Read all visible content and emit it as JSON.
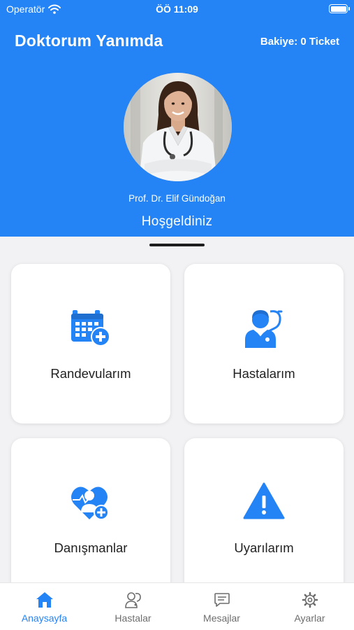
{
  "status_bar": {
    "carrier": "Operatör",
    "time": "ÖÖ 11:09"
  },
  "header": {
    "app_title": "Doktorum Yanımda",
    "balance": "Bakiye: 0 Ticket",
    "doctor_name": "Prof. Dr. Elif Gündoğan",
    "welcome": "Hoşgeldiniz"
  },
  "cards": [
    {
      "label": "Randevularım",
      "icon": "calendar-plus-icon"
    },
    {
      "label": "Hastalarım",
      "icon": "doctor-stethoscope-icon"
    },
    {
      "label": "Danışmanlar",
      "icon": "heart-doctor-plus-icon"
    },
    {
      "label": "Uyarılarım",
      "icon": "warning-triangle-icon"
    }
  ],
  "tabbar": {
    "items": [
      {
        "label": "Anaysayfa",
        "icon": "home-icon",
        "active": true
      },
      {
        "label": "Hastalar",
        "icon": "patients-icon",
        "active": false
      },
      {
        "label": "Mesajlar",
        "icon": "message-icon",
        "active": false
      },
      {
        "label": "Ayarlar",
        "icon": "gear-icon",
        "active": false
      }
    ]
  },
  "colors": {
    "accent": "#2483f5",
    "background": "#f2f2f4",
    "card": "#ffffff",
    "tab_inactive": "#6d6d6d"
  }
}
